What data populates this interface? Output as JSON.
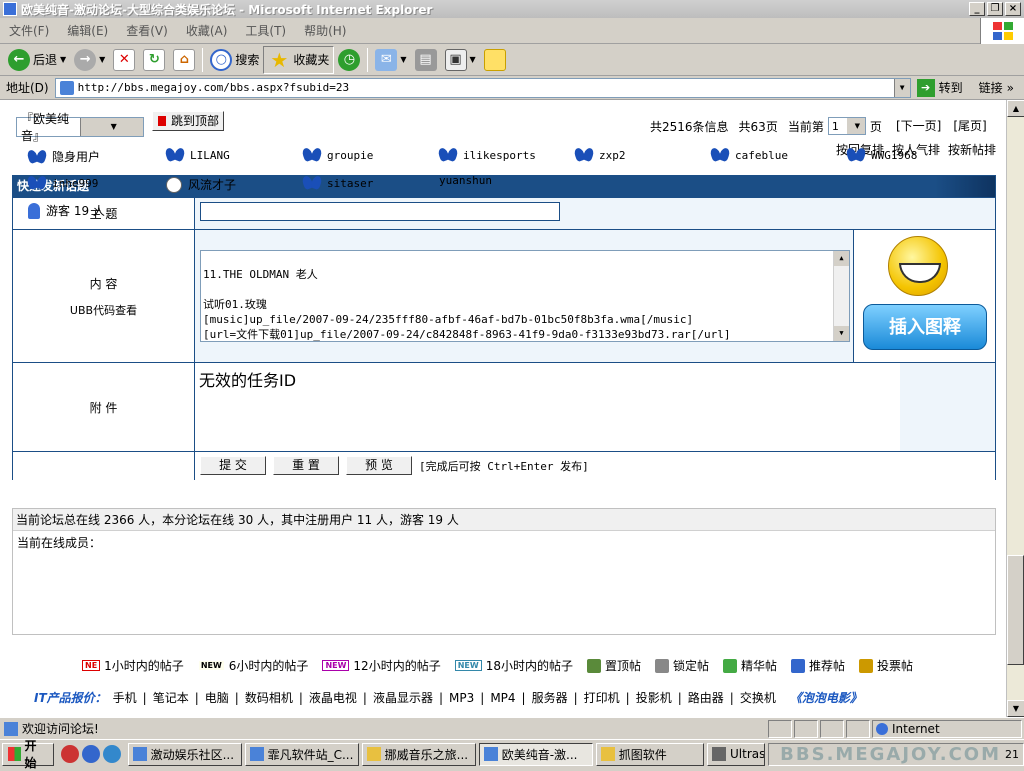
{
  "window": {
    "title": "欧美纯音-激动论坛-大型综合类娱乐论坛 - Microsoft Internet Explorer"
  },
  "menu": [
    "文件(F)",
    "编辑(E)",
    "查看(V)",
    "收藏(A)",
    "工具(T)",
    "帮助(H)"
  ],
  "toolbar": {
    "back": "后退",
    "search": "搜索",
    "favorites": "收藏夹"
  },
  "address": {
    "label": "地址(D)",
    "url": "http://bbs.megajoy.com/bbs.aspx?fsubid=23",
    "go": "转到",
    "links": "链接"
  },
  "forum": {
    "selector": "『欧美纯音』",
    "top_button": "跳到顶部",
    "page_info": {
      "total": "共2516条信息",
      "pages": "共63页",
      "current_label": "当前第",
      "current": "1",
      "page_suffix": "页"
    },
    "next": "[下一页]",
    "last": "[尾页]",
    "sort": [
      "按回复排",
      "按人气排",
      "按新帖排"
    ]
  },
  "post_form": {
    "title": "快速发新话题",
    "subject_label": "主 题",
    "content_label": "内 容",
    "ubb_label": "UBB代码查看",
    "content_text": "11.THE OLDMAN 老人\n\n试听01.玫瑰\n[music]up_file/2007-09-24/235fff80-afbf-46af-bd7b-01bc50f8b3fa.wma[/music]\n[url=文件下载01]up_file/2007-09-24/c842848f-8963-41f9-9da0-f3133e93bd73.rar[/url]",
    "emoticon_button": "插入图释",
    "attach_label": "附 件",
    "attach_msg": "无效的任务ID",
    "submit": "提 交",
    "reset": "重 置",
    "preview": "预 览",
    "hint": "[完成后可按 Ctrl+Enter 发布]"
  },
  "online": {
    "summary": "当前论坛总在线 2366 人，本分论坛在线 30 人，其中注册用户 11 人，游客 19 人",
    "members_label": "当前在线成员：",
    "members": [
      "隐身用户",
      "LILANG",
      "groupie",
      "ilikesports",
      "zxp2",
      "cafeblue",
      "WWG1968",
      "inhe999",
      "风流才子",
      "sitaser",
      "yuanshun"
    ],
    "guests": "游客 19 人"
  },
  "legend": {
    "h1": "1小时内的帖子",
    "h6": "6小时内的帖子",
    "h12": "12小时内的帖子",
    "h18": "18小时内的帖子",
    "top": "置顶帖",
    "lock": "锁定帖",
    "elite": "精华帖",
    "recommend": "推荐帖",
    "vote": "投票帖",
    "tag_ne": "NE",
    "tag_new": "NEW"
  },
  "it_links": {
    "label": "IT产品报价：",
    "items": [
      "手机",
      "笔记本",
      "电脑",
      "数码相机",
      "液晶电视",
      "液晶显示器",
      "MP3",
      "MP4",
      "服务器",
      "打印机",
      "投影机",
      "路由器",
      "交换机"
    ],
    "paopao": "《泡泡电影》"
  },
  "status": {
    "text": "欢迎访问论坛!",
    "zone": "Internet"
  },
  "taskbar": {
    "start": "开始",
    "tasks": [
      "激动娱乐社区...",
      "霏凡软件站_C...",
      "挪威音乐之旅...",
      "欧美纯音-激...",
      "抓图软件",
      "Ultras..."
    ],
    "tray": "BBS.MEGAJOY.COM",
    "clock": "21"
  }
}
